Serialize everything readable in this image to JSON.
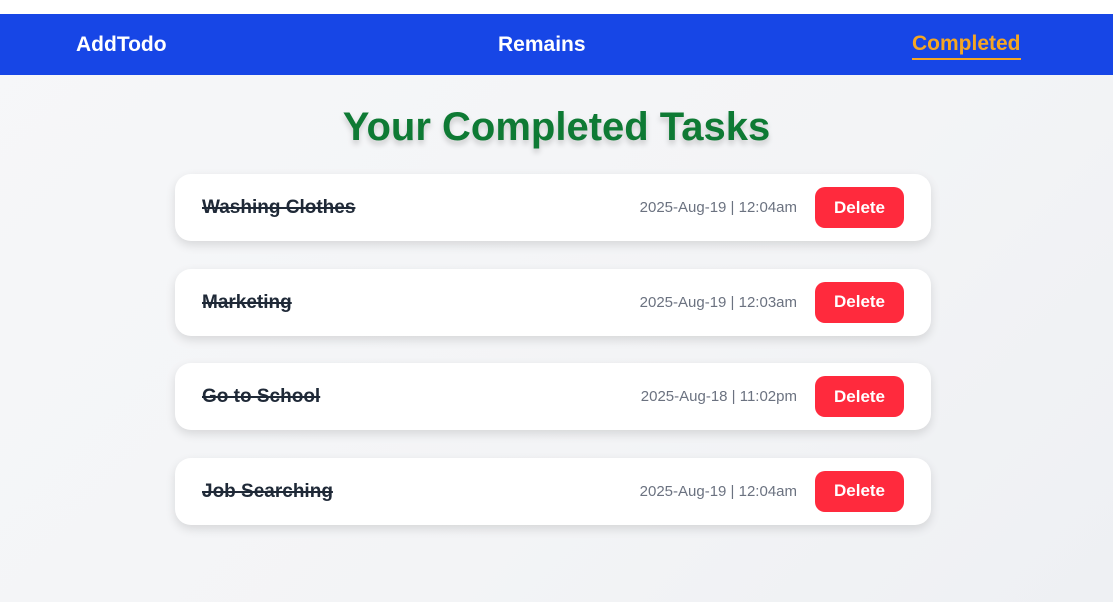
{
  "nav": {
    "add_label": "AddTodo",
    "remains_label": "Remains",
    "completed_label": "Completed",
    "active_color": "#f5a623",
    "bar_color": "#1746e6"
  },
  "main": {
    "title": "Your Completed Tasks",
    "tasks": [
      {
        "title": "Washing Clothes",
        "date": "2025-Aug-19 | 12:04am",
        "delete_label": "Delete"
      },
      {
        "title": "Marketing",
        "date": "2025-Aug-19 | 12:03am",
        "delete_label": "Delete"
      },
      {
        "title": "Go to School",
        "date": "2025-Aug-18 | 11:02pm",
        "delete_label": "Delete"
      },
      {
        "title": "Job Searching",
        "date": "2025-Aug-19 | 12:04am",
        "delete_label": "Delete"
      }
    ]
  },
  "colors": {
    "title": "#0e7a34",
    "delete": "#ff2a3d"
  }
}
